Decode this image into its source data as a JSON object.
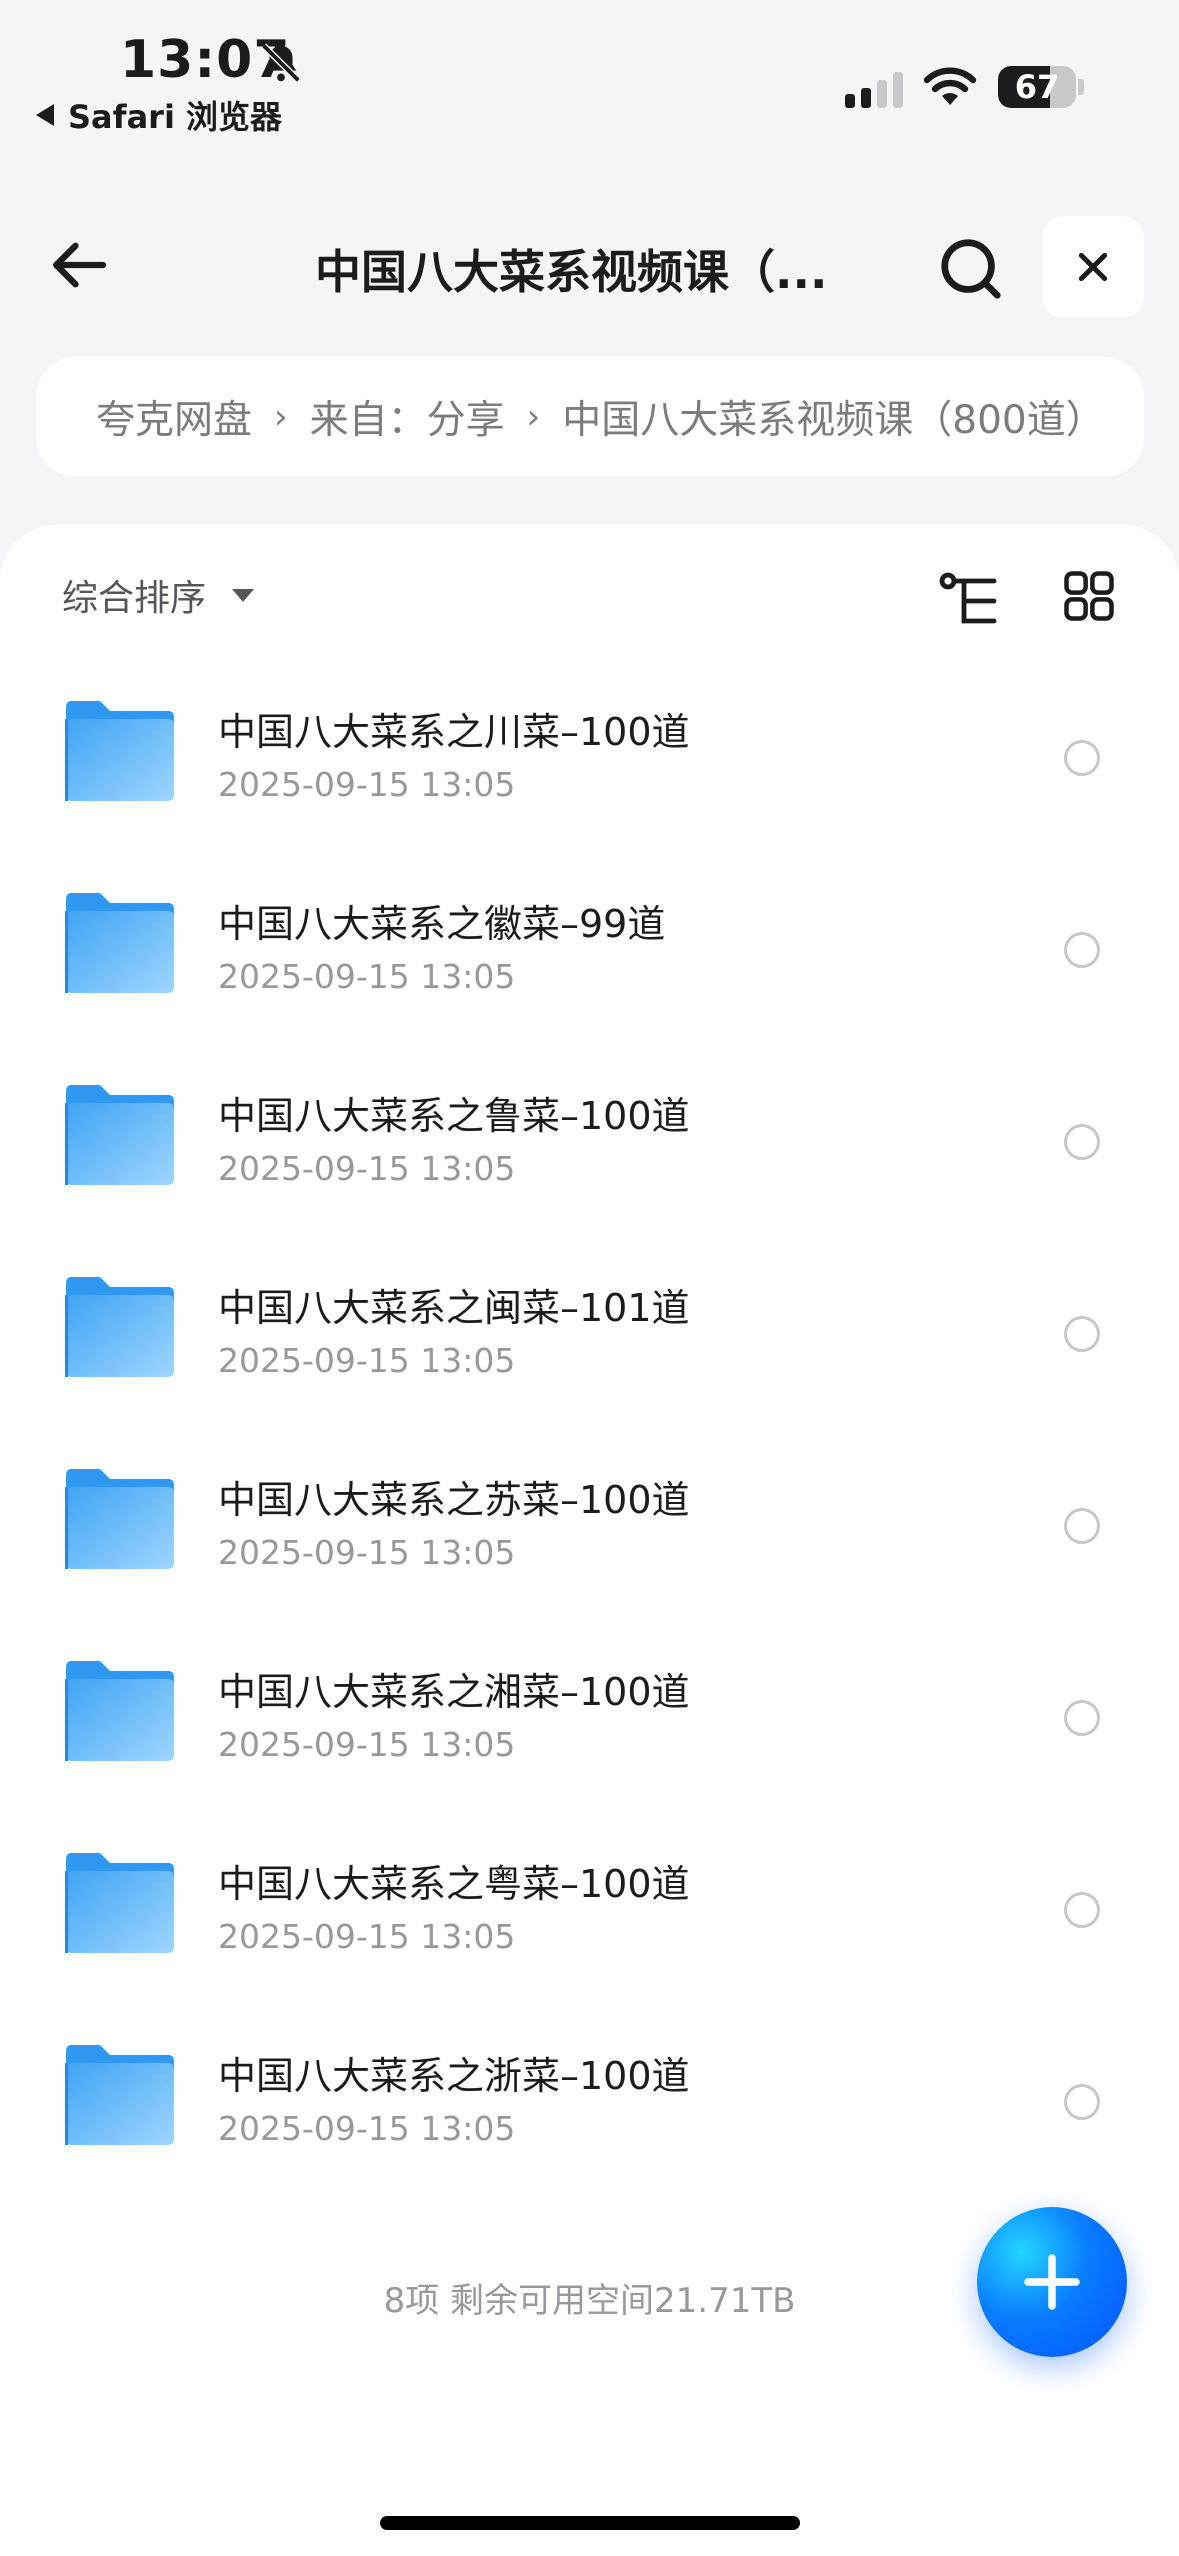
{
  "status_bar": {
    "time": "13:07",
    "back_app": "Safari 浏览器",
    "battery": "67",
    "battery_level": 0.67
  },
  "header": {
    "title": "中国八大菜系视频课（..."
  },
  "breadcrumb": {
    "items": [
      "夸克网盘",
      "来自：分享",
      "中国八大菜系视频课（800道）"
    ]
  },
  "toolbar": {
    "sort_label": "综合排序"
  },
  "files": [
    {
      "name": "中国八大菜系之川菜–100道",
      "time": "2025-09-15 13:05"
    },
    {
      "name": "中国八大菜系之徽菜–99道",
      "time": "2025-09-15 13:05"
    },
    {
      "name": "中国八大菜系之鲁菜–100道",
      "time": "2025-09-15 13:05"
    },
    {
      "name": "中国八大菜系之闽菜–101道",
      "time": "2025-09-15 13:05"
    },
    {
      "name": "中国八大菜系之苏菜–100道",
      "time": "2025-09-15 13:05"
    },
    {
      "name": "中国八大菜系之湘菜–100道",
      "time": "2025-09-15 13:05"
    },
    {
      "name": "中国八大菜系之粤菜–100道",
      "time": "2025-09-15 13:05"
    },
    {
      "name": "中国八大菜系之浙菜–100道",
      "time": "2025-09-15 13:05"
    }
  ],
  "footer": {
    "summary": "8项 剩余可用空间21.71TB"
  },
  "colors": {
    "accent": "#0a7cff",
    "folder": "#4aaaf5"
  }
}
